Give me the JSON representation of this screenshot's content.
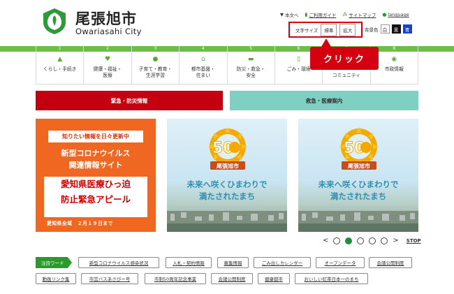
{
  "header": {
    "title_jp": "尾張旭市",
    "title_en": "Owariasahi City",
    "links": [
      {
        "icon": "down-triangle-icon",
        "label": "本文へ"
      },
      {
        "icon": "book-icon",
        "label": "ご利用ガイド"
      },
      {
        "icon": "sitemap-icon",
        "label": "サイトマップ"
      },
      {
        "icon": "globe-icon",
        "label": "language"
      }
    ],
    "font_size": {
      "label": "文字サイズ",
      "standard": "標準",
      "large": "拡大"
    },
    "bg_color": {
      "label": "背景色",
      "white": "白",
      "black": "黒",
      "blue": "青"
    }
  },
  "nav": [
    {
      "num": "1",
      "label": "くらし・手続き",
      "icon": "house-icon"
    },
    {
      "num": "2",
      "label": "健康・福祉・\n医療",
      "icon": "heart-icon"
    },
    {
      "num": "3",
      "label": "子育て・教育・\n生涯学習",
      "icon": "child-icon"
    },
    {
      "num": "4",
      "label": "都市基盤・\n住まい",
      "icon": "home-icon"
    },
    {
      "num": "5",
      "label": "防災・救急・\n安全",
      "icon": "shield-icon"
    },
    {
      "num": "6",
      "label": "ごみ・環境",
      "icon": "trash-icon"
    },
    {
      "num": "7",
      "label": "コミュニティ",
      "icon": "people-icon"
    },
    {
      "num": "8",
      "label": "市政情報",
      "icon": "marker-icon"
    }
  ],
  "callout": "クリック",
  "emergency": {
    "disaster": "緊急・防災情報",
    "rescue": "救急・医療案内"
  },
  "covid_banner": {
    "tag": "知りたい情報を日々更新中",
    "line1": "新型コロナウイルス",
    "line2": "関連情報サイト",
    "appeal1": "愛知県医療ひっ迫",
    "appeal2": "防止緊急アピール",
    "footer": "愛知県全域　２月１９日まで"
  },
  "anniversary_banner": {
    "number": "50",
    "city_name": "尾張旭市",
    "line1": "未来へ咲くひまわりで",
    "line2": "満たされたまち"
  },
  "carousel": {
    "prev": "<",
    "next": ">",
    "stop": "STOP",
    "dots": 5,
    "active": 2
  },
  "keywords": {
    "label": "注目ワード",
    "row1": [
      "新型コロナウイルス感染状況",
      "入札・契約情報",
      "募集情報",
      "ごみ出しカレンダー",
      "オープンデータ",
      "会議公開制度"
    ],
    "row2": [
      "動画リンク集",
      "市営バスあさぴー号",
      "市制50周年記念事業",
      "会議公開制度",
      "健康都市",
      "おいしい紅茶日本一のまち"
    ]
  },
  "colors": {
    "brand_green": "#6bbf45",
    "emergency_red": "#c40010",
    "rescue_teal": "#7fd0c3",
    "covid_orange": "#f06722",
    "highlight_red": "#d4000f"
  }
}
